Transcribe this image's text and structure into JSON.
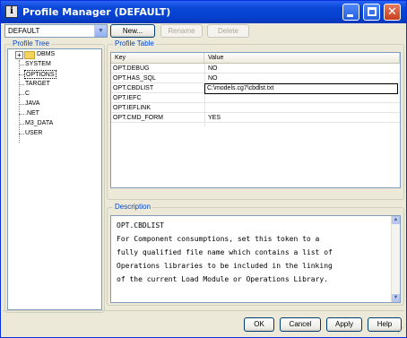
{
  "window": {
    "app_icon": "profile-manager-app-icon",
    "app_icon_glyph": "i",
    "title": "Profile Manager (DEFAULT)",
    "title_buttons": [
      "minimize-icon",
      "maximize-icon",
      "close-icon"
    ],
    "close_glyph": "✕"
  },
  "toolbar": {
    "profile_select": {
      "value": "DEFAULT",
      "dropdown_icon": "chevron-down-icon",
      "dropdown_glyph": "▼"
    },
    "new_label": "New...",
    "rename_label": "Rename",
    "delete_label": "Delete"
  },
  "profile_tree": {
    "label": "Profile Tree",
    "expander": "+",
    "root": {
      "label": "DBMS",
      "icon": "folder-icon"
    },
    "items": [
      {
        "label": "SYSTEM",
        "selected": false
      },
      {
        "label": "OPTIONS",
        "selected": true
      },
      {
        "label": "TARGET",
        "selected": false
      },
      {
        "label": "C",
        "selected": false
      },
      {
        "label": "JAVA",
        "selected": false
      },
      {
        "label": ".NET",
        "selected": false
      },
      {
        "label": "M3_DATA",
        "selected": false
      },
      {
        "label": "USER",
        "selected": false
      }
    ]
  },
  "profile_table": {
    "label": "Profile Table",
    "columns": [
      "Key",
      "Value"
    ],
    "rows": [
      {
        "key": "OPT.DEBUG",
        "value": "NO"
      },
      {
        "key": "OPT.HAS_SQL",
        "value": "NO"
      },
      {
        "key": "OPT.CBDLIST",
        "value": "C:\\models.cg7\\cbdlst.txt",
        "editing": true
      },
      {
        "key": "OPT.IEFC",
        "value": ""
      },
      {
        "key": "OPT.IEFLINK",
        "value": ""
      },
      {
        "key": "OPT.CMD_FORM",
        "value": "YES"
      }
    ]
  },
  "description": {
    "label": "Description",
    "lines": [
      "OPT.CBDLIST",
      "For Component consumptions, set this token to a",
      "fully qualified file name which contains a list of",
      "Operations libraries to be included in the linking",
      "of the current Load Module or Operations Library."
    ],
    "scroll_up_glyph": "▲",
    "scroll_down_glyph": "▼"
  },
  "buttons": {
    "ok": "OK",
    "cancel": "Cancel",
    "apply": "Apply",
    "help": "Help"
  },
  "resize_grip": "resize-grip-icon",
  "resize_grip_glyph": "⋰",
  "colors": {
    "titlebar": "#0A48D8",
    "group_label": "#0046D5",
    "dialog_bg": "#ECE9D8"
  }
}
